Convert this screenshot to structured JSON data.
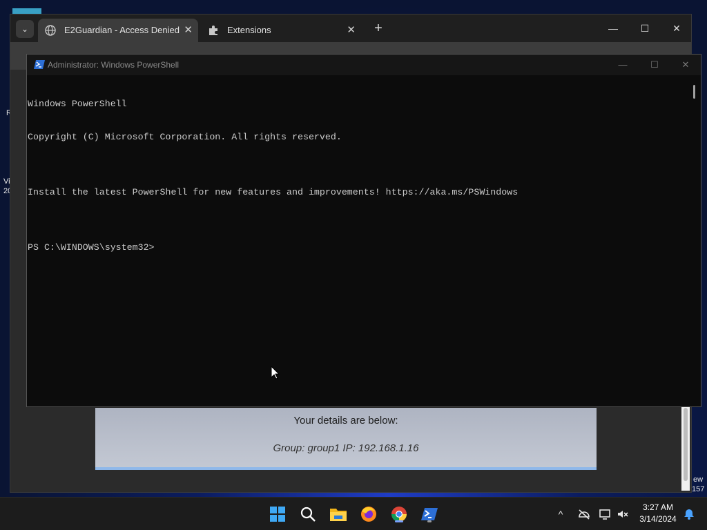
{
  "desktop": {
    "stub_left_1": "R",
    "stub_left_2": "Vi",
    "stub_left_3": "20",
    "stub_right_1": "ew",
    "stub_right_2": "157"
  },
  "chrome": {
    "tabs": [
      {
        "label": "E2Guardian - Access Denied",
        "icon": "globe-icon",
        "close": "✕",
        "active": true
      },
      {
        "label": "Extensions",
        "icon": "puzzle-icon",
        "close": "✕",
        "active": false
      }
    ],
    "new_tab": "+",
    "tab_search": "⌄",
    "controls": {
      "minimize": "—",
      "maximize": "☐",
      "close": "✕"
    }
  },
  "e2guardian": {
    "heading": "Your details are below:",
    "details": "Group: group1   IP: 192.168.1.16"
  },
  "powershell": {
    "title": "Administrator: Windows PowerShell",
    "controls": {
      "minimize": "—",
      "maximize": "☐",
      "close": "✕"
    },
    "console_lines": [
      "Windows PowerShell",
      "Copyright (C) Microsoft Corporation. All rights reserved.",
      "",
      "Install the latest PowerShell for new features and improvements! https://aka.ms/PSWindows",
      "",
      "PS C:\\WINDOWS\\system32>"
    ]
  },
  "taskbar": {
    "apps": [
      {
        "name": "start-icon"
      },
      {
        "name": "search-icon"
      },
      {
        "name": "file-explorer-icon"
      },
      {
        "name": "firefox-icon"
      },
      {
        "name": "chrome-icon"
      },
      {
        "name": "powershell-icon"
      }
    ],
    "tray": {
      "chevron": "^",
      "time": "3:27 AM",
      "date": "3/14/2024"
    },
    "colors": {
      "accent": "#7aa0ff",
      "taskbar_bg": "#1c1c1c"
    }
  }
}
